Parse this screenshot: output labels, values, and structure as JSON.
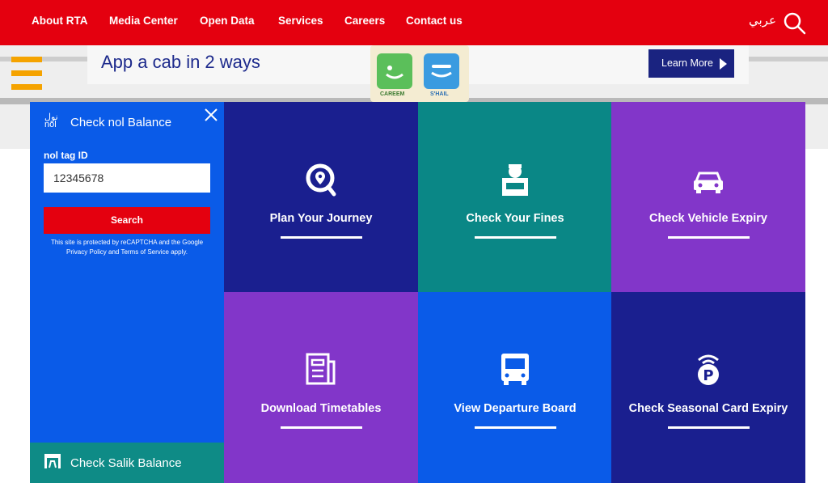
{
  "nav": {
    "items": [
      "About RTA",
      "Media Center",
      "Open Data",
      "Services",
      "Careers",
      "Contact us"
    ],
    "language": "عربي"
  },
  "banner": {
    "title": "App a cab in 2 ways",
    "learn_more": "Learn More",
    "app1_name": "CAREEM",
    "app2_name": "S'HAIL"
  },
  "nol": {
    "logo": "نول nol",
    "title": "Check nol Balance",
    "field_label": "nol tag ID",
    "field_value": "12345678",
    "search_label": "Search",
    "recaptcha_line1": "This site is protected by reCAPTCHA and the Google",
    "recaptcha_line2": "Privacy Policy and Terms of Service apply."
  },
  "salik": {
    "title": "Check Salik Balance"
  },
  "tiles": [
    {
      "label": "Plan Your Journey",
      "icon": "map-pin-search-icon",
      "color": "#1a1f8f"
    },
    {
      "label": "Check Your Fines",
      "icon": "officer-icon",
      "color": "#0a8786"
    },
    {
      "label": "Check Vehicle Expiry",
      "icon": "car-icon",
      "color": "#8236c9"
    },
    {
      "label": "Download Timetables",
      "icon": "timetable-document-icon",
      "color": "#8236c9"
    },
    {
      "label": "View Departure Board",
      "icon": "bus-icon",
      "color": "#0a5be8"
    },
    {
      "label": "Check Seasonal Card Expiry",
      "icon": "parking-card-icon",
      "color": "#1a1f8f"
    }
  ]
}
